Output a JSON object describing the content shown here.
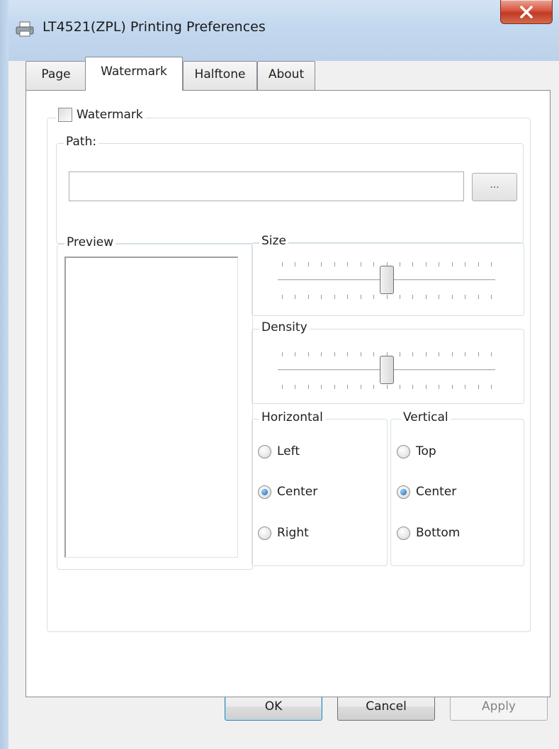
{
  "window": {
    "title": "LT4521(ZPL) Printing Preferences",
    "icon": "printer-icon",
    "close_icon": "close-icon"
  },
  "tabs": [
    {
      "label": "Page"
    },
    {
      "label": "Watermark"
    },
    {
      "label": "Halftone"
    },
    {
      "label": "About"
    }
  ],
  "active_tab": "Watermark",
  "watermark": {
    "checkbox_label": "Watermark",
    "checked": false,
    "path_label": "Path:",
    "path_value": "",
    "browse_label": "..."
  },
  "preview": {
    "label": "Preview"
  },
  "size": {
    "label": "Size",
    "level": 0.5
  },
  "density": {
    "label": "Density",
    "level": 0.5
  },
  "horizontal": {
    "label": "Horizontal",
    "options": [
      "Left",
      "Center",
      "Right"
    ],
    "selected": "Center"
  },
  "vertical": {
    "label": "Vertical",
    "options": [
      "Top",
      "Center",
      "Bottom"
    ],
    "selected": "Center"
  },
  "buttons": {
    "ok": "OK",
    "cancel": "Cancel",
    "apply": "Apply"
  }
}
